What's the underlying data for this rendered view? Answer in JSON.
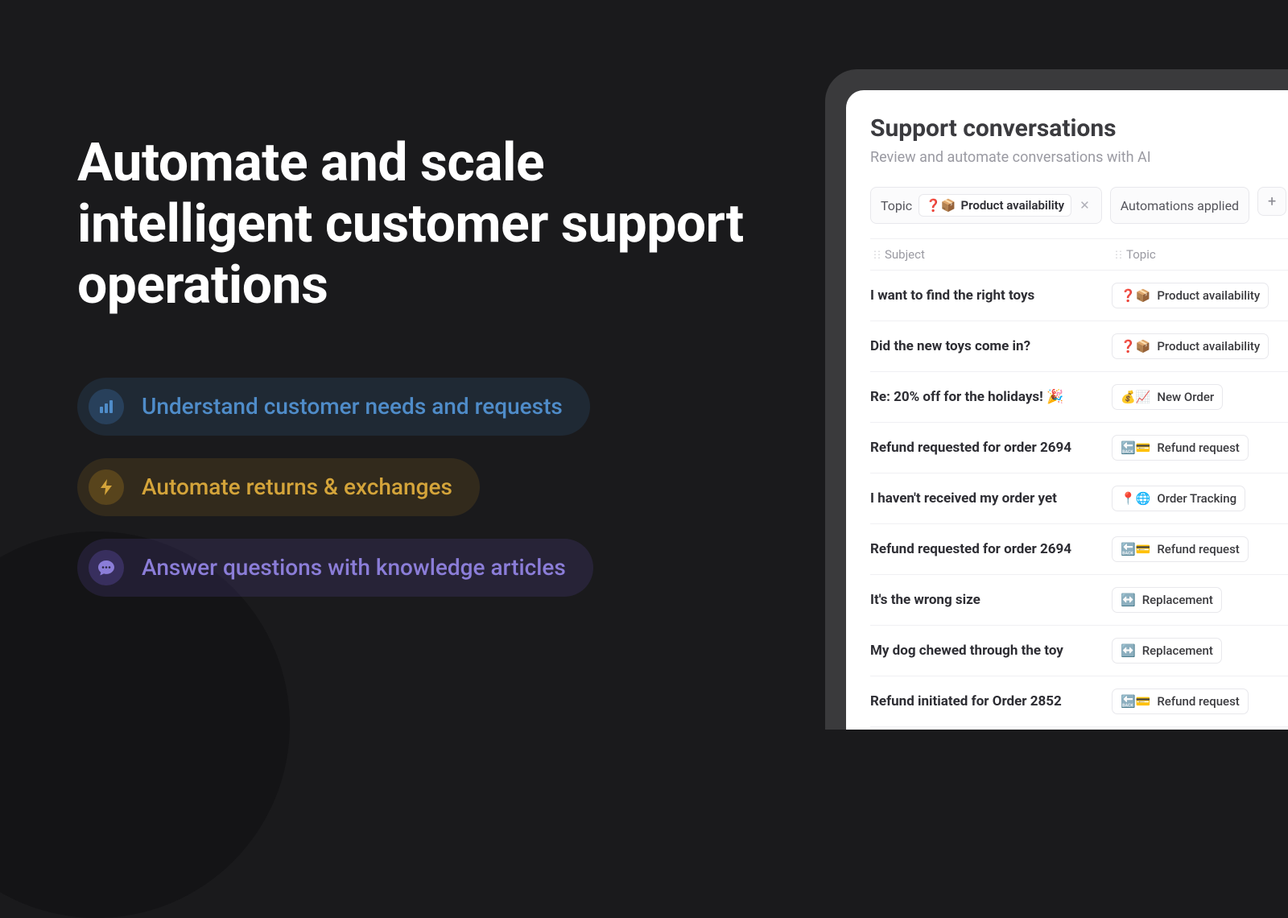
{
  "hero": {
    "title": "Automate and scale intelligent customer support operations",
    "pills": [
      {
        "label": "Understand customer needs and requests",
        "icon": "bar-chart-icon",
        "variant": "blue"
      },
      {
        "label": "Automate returns & exchanges",
        "icon": "lightning-icon",
        "variant": "amber"
      },
      {
        "label": "Answer questions with knowledge articles",
        "icon": "chat-icon",
        "variant": "purple"
      }
    ]
  },
  "panel": {
    "title": "Support conversations",
    "subtitle": "Review and automate conversations with AI",
    "filters": {
      "topic_label": "Topic",
      "topic_value": "Product availability",
      "topic_emoji": "❓📦",
      "automations_label": "Automations applied"
    },
    "columns": {
      "subject": "Subject",
      "topic": "Topic"
    },
    "rows": [
      {
        "subject": "I want to find the right toys",
        "topic": "Product availability",
        "emoji": "❓📦"
      },
      {
        "subject": "Did the new toys come in?",
        "topic": "Product availability",
        "emoji": "❓📦"
      },
      {
        "subject": "Re: 20% off for the holidays! 🎉",
        "topic": "New Order",
        "emoji": "💰📈"
      },
      {
        "subject": "Refund requested for order 2694",
        "topic": "Refund request",
        "emoji": "🔙💳"
      },
      {
        "subject": "I haven't received my order yet",
        "topic": "Order Tracking",
        "emoji": "📍🌐"
      },
      {
        "subject": "Refund requested for order 2694",
        "topic": "Refund request",
        "emoji": "🔙💳"
      },
      {
        "subject": "It's the wrong size",
        "topic": "Replacement",
        "emoji": "↔️"
      },
      {
        "subject": "My dog chewed through the toy",
        "topic": "Replacement",
        "emoji": "↔️"
      },
      {
        "subject": "Refund initiated for Order 2852",
        "topic": "Refund request",
        "emoji": "🔙💳"
      }
    ]
  }
}
